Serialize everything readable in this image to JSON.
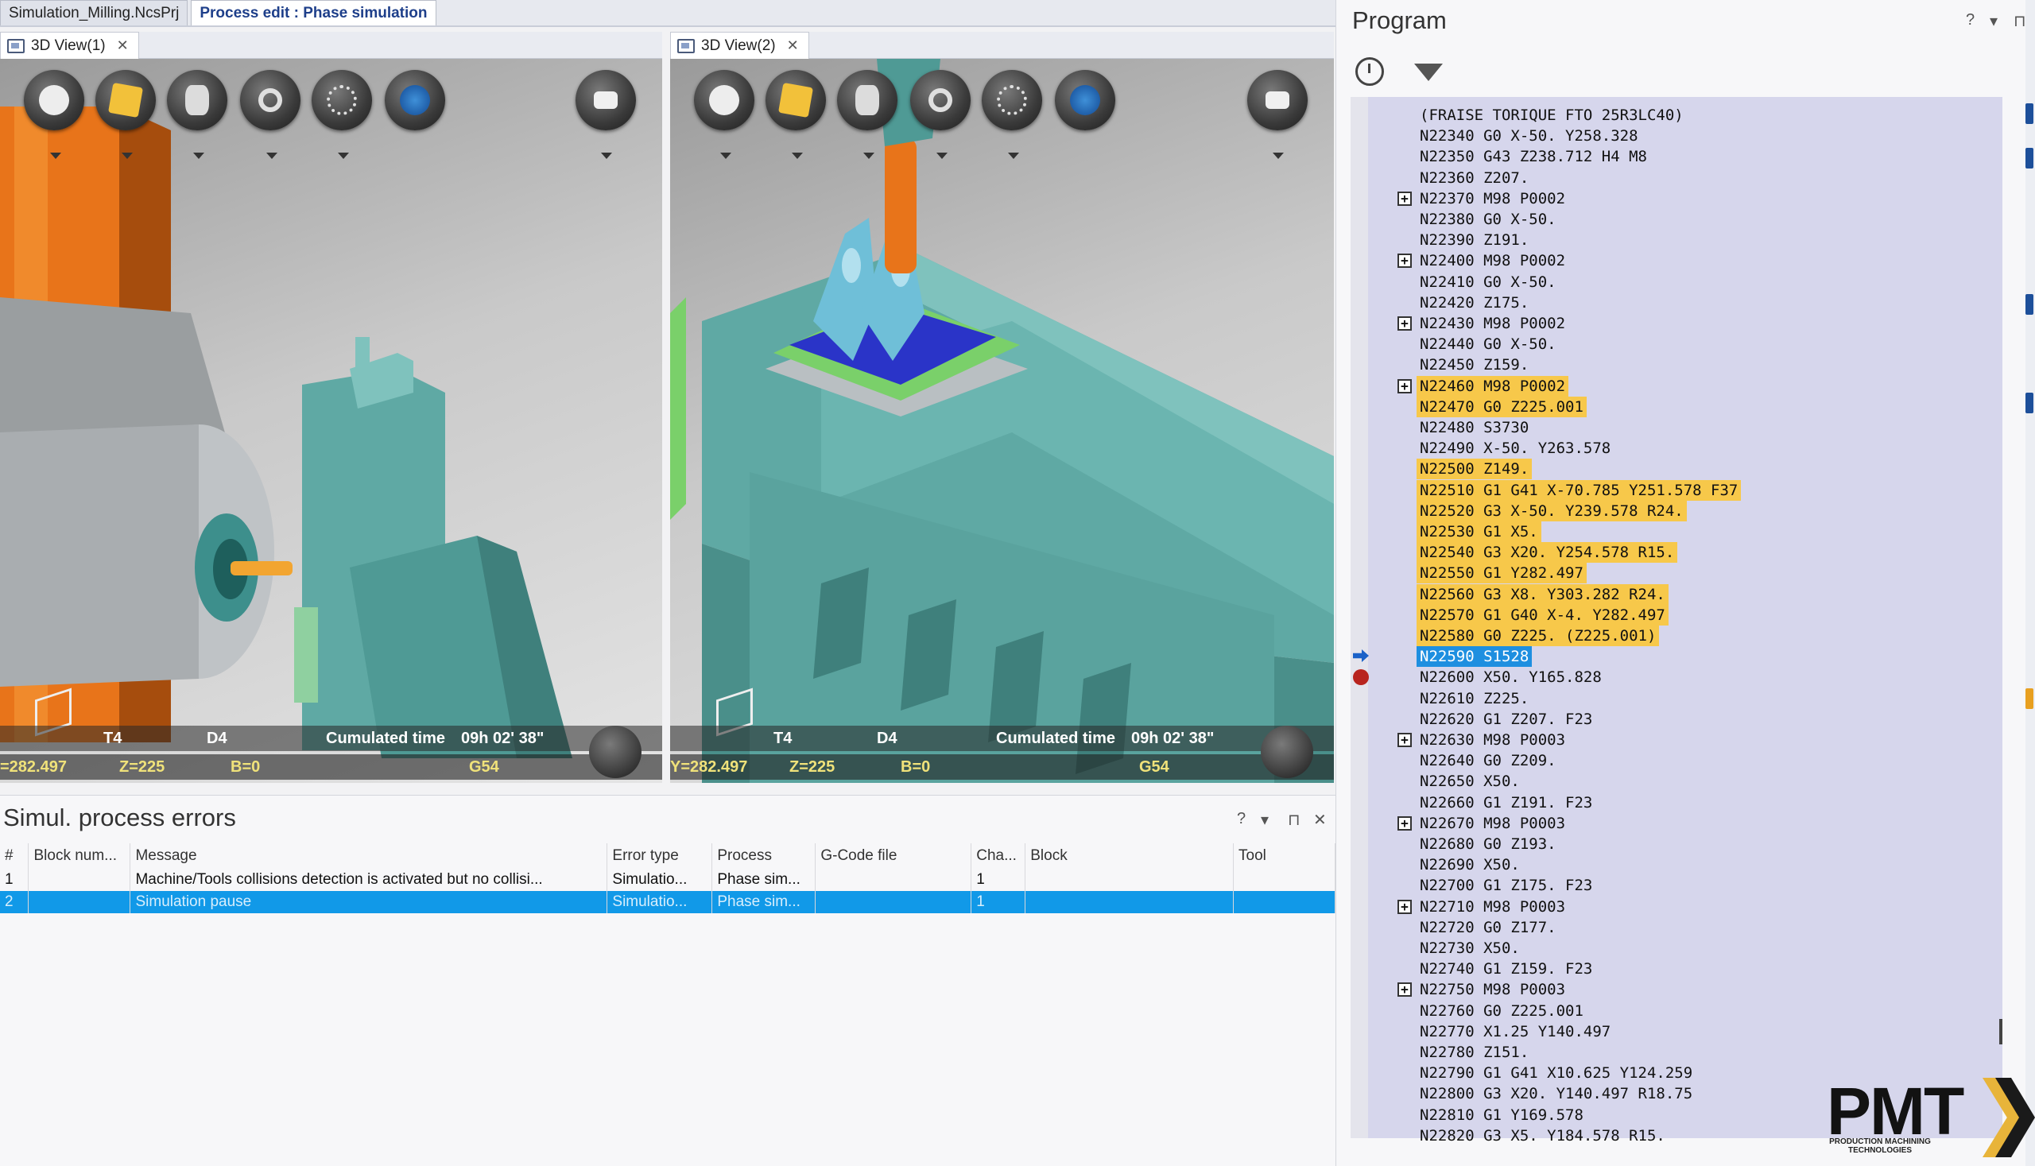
{
  "doc_tabs": [
    "Simulation_Milling.NcsPrj",
    "Process edit : Phase simulation"
  ],
  "views": [
    {
      "tab_label": "3D View(1)",
      "tool": "T4",
      "d": "D4",
      "cumulated_label": "Cumulated time",
      "cumulated_value": "09h 02' 38\"",
      "y_value": "=282.497",
      "z_value": "Z=225",
      "b_value": "B=0",
      "wcs": "G54"
    },
    {
      "tab_label": "3D View(2)",
      "tool": "T4",
      "d": "D4",
      "cumulated_label": "Cumulated time",
      "cumulated_value": "09h 02' 38\"",
      "y_value": "Y=282.497",
      "z_value": "Z=225",
      "b_value": "B=0",
      "wcs": "G54"
    }
  ],
  "errors": {
    "title": "Simul. process errors",
    "controls": [
      "?",
      "▾",
      "⊓",
      "✕"
    ],
    "columns": [
      "#",
      "Block num...",
      "Message",
      "Error type",
      "Process",
      "G-Code file",
      "Cha...",
      "Block",
      "Tool"
    ],
    "rows": [
      [
        "1",
        "",
        "Machine/Tools collisions detection is activated but no collisi...",
        "Simulatio...",
        "Phase sim...",
        "",
        "1",
        "",
        ""
      ],
      [
        "2",
        "",
        "Simulation pause",
        "Simulatio...",
        "Phase sim...",
        "",
        "1",
        "",
        ""
      ]
    ]
  },
  "program": {
    "title": "Program",
    "controls": [
      "?",
      "▾",
      "⊓"
    ],
    "lines": [
      "(FRAISE TORIQUE FTO 25R3LC40)",
      "N22340 G0 X-50. Y258.328",
      "N22350 G43 Z238.712 H4 M8",
      "N22360 Z207.",
      "N22370 M98 P0002",
      "N22380 G0 X-50.",
      "N22390 Z191.",
      "N22400 M98 P0002",
      "N22410 G0 X-50.",
      "N22420 Z175.",
      "N22430 M98 P0002",
      "N22440 G0 X-50.",
      "N22450 Z159.",
      "N22460 M98 P0002",
      "N22470 G0 Z225.001",
      "N22480 S3730",
      "N22490 X-50. Y263.578",
      "N22500 Z149.",
      "N22510 G1 G41 X-70.785 Y251.578 F37",
      "N22520 G3 X-50. Y239.578 R24.",
      "N22530 G1 X5.",
      "N22540 G3 X20. Y254.578 R15.",
      "N22550 G1 Y282.497",
      "N22560 G3 X8. Y303.282 R24.",
      "N22570 G1 G40 X-4. Y282.497",
      "N22580 G0 Z225. (Z225.001)",
      "N22590 S1528",
      "N22600 X50. Y165.828",
      "N22610 Z225.",
      "N22620 G1 Z207. F23",
      "N22630 M98 P0003",
      "N22640 G0 Z209.",
      "N22650 X50.",
      "N22660 G1 Z191. F23",
      "N22670 M98 P0003",
      "N22680 G0 Z193.",
      "N22690 X50.",
      "N22700 G1 Z175. F23",
      "N22710 M98 P0003",
      "N22720 G0 Z177.",
      "N22730 X50.",
      "N22740 G1 Z159. F23",
      "N22750 M98 P0003",
      "N22760 G0 Z225.001",
      "N22770 X1.25 Y140.497",
      "N22780 Z151.",
      "N22790 G1 G41 X10.625 Y124.259",
      "N22800 G3 X20. Y140.497 R18.75",
      "N22810 G1 Y169.578",
      "N22820 G3 X5. Y184.578 R15."
    ],
    "expandable_lines": [
      4,
      7,
      10,
      13,
      30,
      34,
      38,
      42
    ],
    "highlighted_lines": [
      13,
      14,
      17,
      18,
      19,
      20,
      21,
      22,
      23,
      24,
      25
    ],
    "current_line": 26,
    "breakpoint_line": 27
  },
  "logo": {
    "text": "PMT",
    "subtitle": "PRODUCTION MACHINING TECHNOLOGIES"
  },
  "colors": {
    "highlight": "#f7c84a",
    "current": "#1e8fe0",
    "selected_row": "#1199e8",
    "machine_teal": "#5fa9a4",
    "machine_orange": "#e8741a"
  }
}
